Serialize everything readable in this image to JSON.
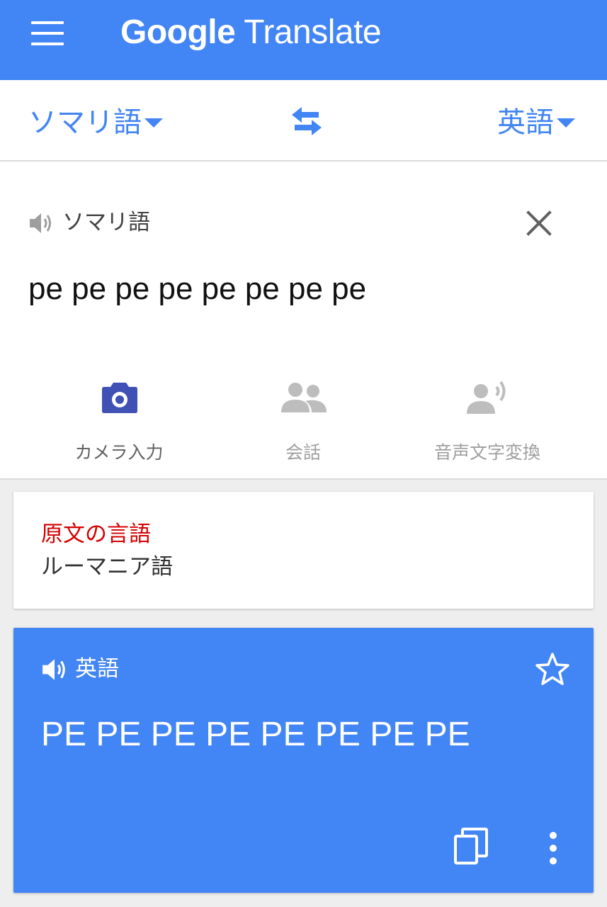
{
  "app_bar": {
    "title_brand": "Google",
    "title_product": "Translate",
    "menu_icon": "hamburger-menu-icon",
    "background": "#4285f4"
  },
  "language_bar": {
    "source_language": "ソマリ語",
    "target_language": "英語",
    "swap_icon": "swap-arrows-icon",
    "accent": "#4285f4"
  },
  "input": {
    "language_label": "ソマリ語",
    "text": "pe pe pe pe pe pe pe pe",
    "speaker_icon": "speaker-icon",
    "clear_icon": "close-icon"
  },
  "tools": [
    {
      "label": "カメラ入力",
      "icon": "camera-icon",
      "active": true
    },
    {
      "label": "会話",
      "icon": "conversation-icon",
      "active": false
    },
    {
      "label": "音声文字変換",
      "icon": "transcribe-icon",
      "active": false
    }
  ],
  "detected": {
    "title": "原文の言語",
    "language": "ルーマニア語",
    "title_color": "#d50000"
  },
  "result": {
    "language_label": "英語",
    "text": "PE PE PE PE PE PE PE PE",
    "background": "#4285f4",
    "star_icon": "star-outline-icon",
    "copy_icon": "copy-icon",
    "more_icon": "more-vertical-icon"
  }
}
